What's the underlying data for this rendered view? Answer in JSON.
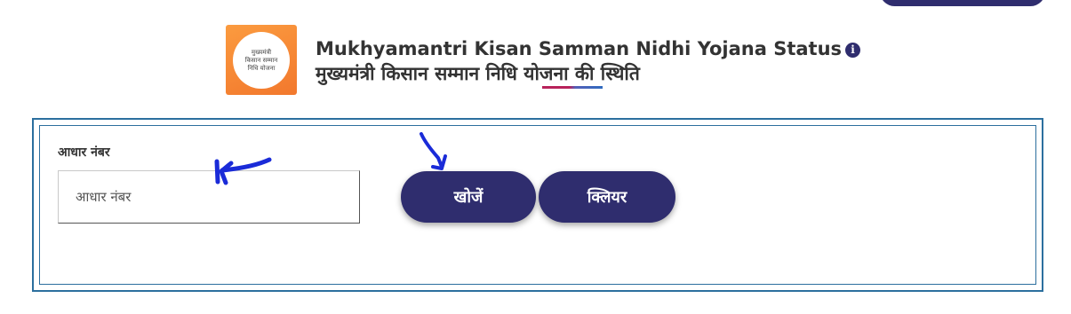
{
  "header": {
    "logo": {
      "lines": [
        "मुख्यमंत्री",
        "किसान सम्मान",
        "निधि योजना"
      ]
    },
    "title_en": "Mukhyamantri Kisan Samman Nidhi Yojana Status",
    "info_icon_glyph": "i",
    "title_hi": "मुख्यमंत्री किसान सम्मान निधि योजना की स्थिति"
  },
  "form": {
    "aadhaar_label": "आधार नंबर",
    "aadhaar_placeholder": "आधार नंबर",
    "aadhaar_value": "",
    "search_button": "खोजें",
    "clear_button": "क्लियर"
  },
  "annotations": {
    "color": "#1a2bd8",
    "icons": [
      "arrow-to-input-icon",
      "arrow-to-search-button-icon"
    ]
  },
  "colors": {
    "primary": "#2f2d6e",
    "panel_border": "#2c6f9e",
    "logo_orange": "#f58634"
  }
}
